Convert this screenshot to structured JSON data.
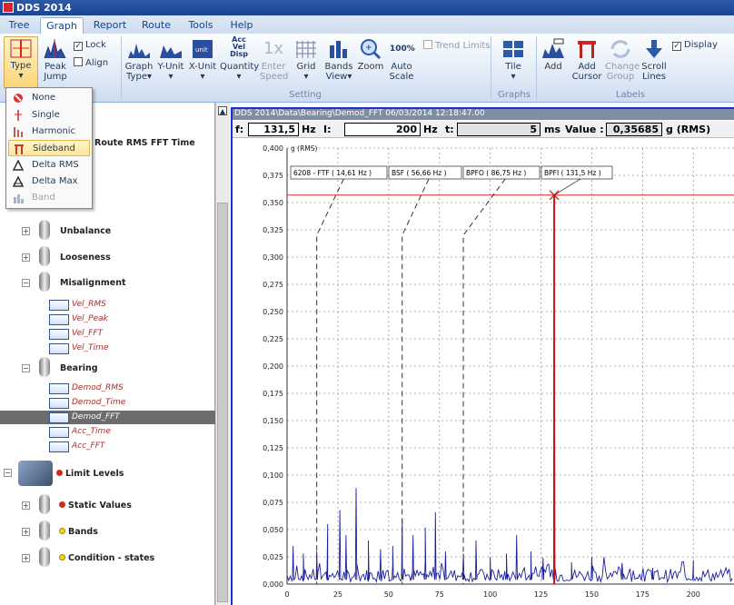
{
  "app": {
    "title": "DDS 2014"
  },
  "tabs": [
    {
      "label": "Tree",
      "active": false
    },
    {
      "label": "Graph",
      "active": true
    },
    {
      "label": "Report",
      "active": false
    },
    {
      "label": "Route",
      "active": false
    },
    {
      "label": "Tools",
      "active": false
    },
    {
      "label": "Help",
      "active": false
    }
  ],
  "ribbon": {
    "type_label": "Type",
    "peak_jump_label1": "Peak",
    "peak_jump_label2": "Jump",
    "lock_label": "Lock",
    "align_label": "Align",
    "graph_type_label1": "Graph",
    "graph_type_label2": "Type",
    "y_unit_label": "Y-Unit",
    "x_unit_label": "X-Unit",
    "quantity_label": "Quantity",
    "quantity_icon_text": "Acc Vel Disp",
    "enter_speed_icon_text": "1x",
    "enter_speed_label1": "Enter",
    "enter_speed_label2": "Speed",
    "grid_label": "Grid",
    "bands_view_label1": "Bands",
    "bands_view_label2": "View",
    "zoom_label": "Zoom",
    "auto_scale_icon_text": "100%",
    "auto_scale_label1": "Auto",
    "auto_scale_label2": "Scale",
    "trend_limits_label": "Trend Limits",
    "setting_group": "Setting",
    "tile_label": "Tile",
    "graphs_group": "Graphs",
    "add_label": "Add",
    "add_cursor_label1": "Add",
    "add_cursor_label2": "Cursor",
    "change_group_label1": "Change",
    "change_group_label2": "Group",
    "scroll_lines_label1": "Scroll",
    "scroll_lines_label2": "Lines",
    "display_label": "Display",
    "labels_group": "Labels",
    "lock_checked": true,
    "align_checked": false,
    "trend_limits_checked": false,
    "display_checked": true
  },
  "type_menu": [
    {
      "label": "None",
      "icon": "none-icon",
      "highlighted": false,
      "disabled": false
    },
    {
      "label": "Single",
      "icon": "single-cursor-icon",
      "highlighted": false,
      "disabled": false
    },
    {
      "label": "Harmonic",
      "icon": "harmonic-icon",
      "highlighted": false,
      "disabled": false
    },
    {
      "label": "Sideband",
      "icon": "sideband-icon",
      "highlighted": true,
      "disabled": false
    },
    {
      "label": "Delta RMS",
      "icon": "delta-rms-icon",
      "highlighted": false,
      "disabled": false
    },
    {
      "label": "Delta Max",
      "icon": "delta-max-icon",
      "highlighted": false,
      "disabled": false
    },
    {
      "label": "Band",
      "icon": "band-icon",
      "highlighted": false,
      "disabled": true
    }
  ],
  "tree": {
    "route_title": "Route RMS FFT Time",
    "groups": [
      {
        "label": "Unbalance"
      },
      {
        "label": "Looseness"
      },
      {
        "label": "Misalignment"
      },
      {
        "label": "Bearing"
      }
    ],
    "misalignment_items": [
      "Vel_RMS",
      "Vel_Peak",
      "Vel_FFT",
      "Vel_Time"
    ],
    "bearing_items": [
      "Demod_RMS",
      "Demod_Time",
      "Demod_FFT",
      "Acc_Time",
      "Acc_FFT"
    ],
    "selected_item": "Demod_FFT",
    "limit_levels": "Limit Levels",
    "static_values": "Static Values",
    "bands": "Bands",
    "condition_states": "Condition - states",
    "colors": {
      "limit": "#d42a1a",
      "static": "#d42a1a",
      "bands": "#f2d21b",
      "condition": "#f2d21b"
    }
  },
  "chart": {
    "path_text": "DDS 2014\\Data\\Bearing\\Demod_FFT   06/03/2014 12:18:47.00",
    "f_label": "f:",
    "f_value": "131,5",
    "f_unit": "Hz",
    "i_label": "I:",
    "i_value": "200",
    "i_unit": "Hz",
    "t_label": "t:",
    "t_value": "5",
    "t_unit": "ms",
    "value_label": "Value :",
    "value_value": "0,35685",
    "value_unit": "g  (RMS)"
  },
  "chart_data": {
    "type": "line",
    "ylabel": "g  (RMS)",
    "xlim": [
      0,
      220
    ],
    "ylim": [
      0,
      0.4
    ],
    "xticks": [
      "0",
      "25",
      "50",
      "75",
      "100",
      "125",
      "150",
      "175",
      "200"
    ],
    "yticks": [
      "0,000",
      "0,025",
      "0,050",
      "0,075",
      "0,100",
      "0,125",
      "0,150",
      "0,175",
      "0,200",
      "0,225",
      "0,250",
      "0,275",
      "0,300",
      "0,325",
      "0,350",
      "0,375",
      "0,400"
    ],
    "grid": true,
    "cursor": {
      "x": 131.5,
      "y": 0.35685
    },
    "markers": [
      {
        "label": "6208 - FTF  ( 14,61 Hz )",
        "x": 14.61
      },
      {
        "label": "BSF  ( 56,66 Hz )",
        "x": 56.66
      },
      {
        "label": "BPFO  ( 86,75 Hz )",
        "x": 86.75
      },
      {
        "label": "BPFI  ( 131,5 Hz )",
        "x": 131.5
      }
    ],
    "peaks": [
      {
        "x": 3,
        "y": 0.035
      },
      {
        "x": 8,
        "y": 0.028
      },
      {
        "x": 14.6,
        "y": 0.03
      },
      {
        "x": 20,
        "y": 0.055
      },
      {
        "x": 26,
        "y": 0.068
      },
      {
        "x": 29,
        "y": 0.045
      },
      {
        "x": 34,
        "y": 0.088
      },
      {
        "x": 40,
        "y": 0.04
      },
      {
        "x": 46,
        "y": 0.032
      },
      {
        "x": 52,
        "y": 0.035
      },
      {
        "x": 56.7,
        "y": 0.06
      },
      {
        "x": 62,
        "y": 0.045
      },
      {
        "x": 68,
        "y": 0.052
      },
      {
        "x": 73,
        "y": 0.066
      },
      {
        "x": 78,
        "y": 0.03
      },
      {
        "x": 86.8,
        "y": 0.028
      },
      {
        "x": 93,
        "y": 0.04
      },
      {
        "x": 100,
        "y": 0.025
      },
      {
        "x": 108,
        "y": 0.028
      },
      {
        "x": 113,
        "y": 0.045
      },
      {
        "x": 120,
        "y": 0.03
      },
      {
        "x": 126,
        "y": 0.024
      },
      {
        "x": 131.5,
        "y": 0.357
      },
      {
        "x": 140,
        "y": 0.02
      },
      {
        "x": 150,
        "y": 0.025
      },
      {
        "x": 165,
        "y": 0.018
      },
      {
        "x": 180,
        "y": 0.015
      },
      {
        "x": 200,
        "y": 0.022
      }
    ]
  }
}
